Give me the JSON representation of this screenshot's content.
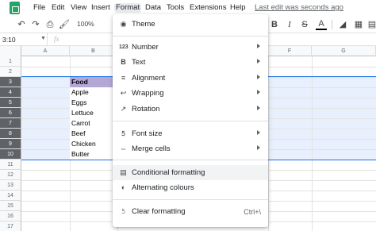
{
  "menubar": {
    "items": [
      "File",
      "Edit",
      "View",
      "Insert",
      "Format",
      "Data",
      "Tools",
      "Extensions",
      "Help"
    ],
    "last_edit": "Last edit was seconds ago"
  },
  "toolbar": {
    "zoom": "100%"
  },
  "formula_bar": {
    "name_box": "3:10",
    "fx": "fx"
  },
  "columns": [
    "A",
    "B",
    "F",
    "G"
  ],
  "rows": [
    "1",
    "2",
    "3",
    "4",
    "5",
    "6",
    "7",
    "8",
    "9",
    "10",
    "11",
    "12",
    "13",
    "14",
    "15",
    "16",
    "17"
  ],
  "selected_rows": [
    "3",
    "4",
    "5",
    "6",
    "7",
    "8",
    "9",
    "10"
  ],
  "cells": {
    "b3": "Food",
    "b4": "Apple",
    "b5": "Eggs",
    "b6": "Lettuce",
    "b7": "Carrot",
    "b8": "Beef",
    "b9": "Chicken",
    "b10": "Butter"
  },
  "format_menu": {
    "theme": "Theme",
    "number": "Number",
    "text": "Text",
    "alignment": "Alignment",
    "wrapping": "Wrapping",
    "rotation": "Rotation",
    "font_size": "Font size",
    "merge_cells": "Merge cells",
    "conditional_formatting": "Conditional formatting",
    "alternating_colours": "Alternating colours",
    "clear_formatting": "Clear formatting",
    "clear_formatting_shortcut": "Ctrl+\\"
  },
  "colors": {
    "selection_fill": "#e8f0fe",
    "selection_border": "#1a73e8",
    "header_cell": "#b4a7d6",
    "sheets_green": "#23a566"
  }
}
